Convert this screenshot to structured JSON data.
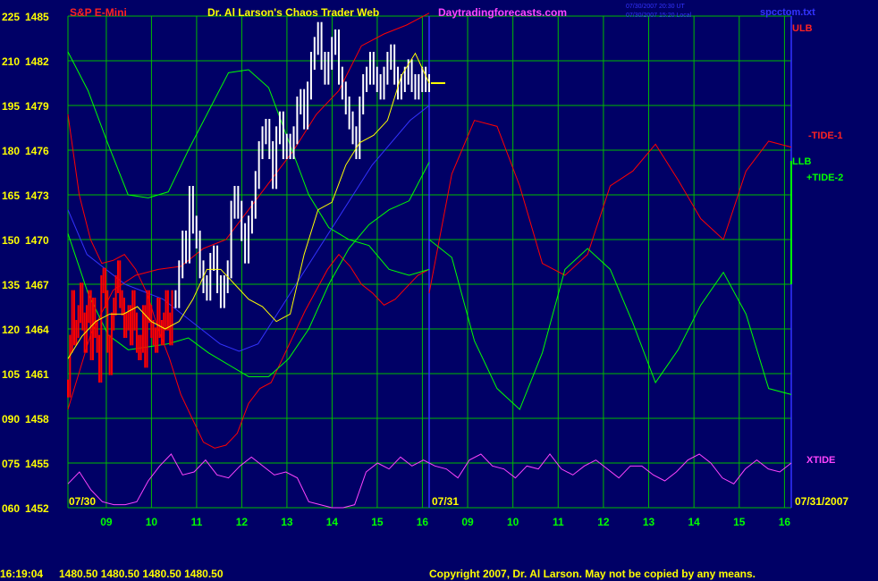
{
  "header": {
    "instrument": "S&P E-Mini",
    "title": "Dr. Al Larson's Chaos Trader Web",
    "site": "Daytradingforecasts.com",
    "stamp_line1": "07/30/2007 20:30 UT",
    "stamp_line2": "07/30/2007 15:20 Local",
    "file": "spcctom.txt"
  },
  "footer": {
    "time": "16:19:04",
    "quotes": "1480.50 1480.50 1480.50 1480.50",
    "copyright": "Copyright 2007, Dr. Al Larson. May not be copied by any means."
  },
  "colors": {
    "background": "#000066",
    "grid": "#00bb00",
    "red": "#ff0000",
    "green": "#00ff00",
    "magenta": "#ff44ff",
    "yellow": "#ffff00",
    "white": "#ffffff",
    "blue": "#3333ff"
  },
  "chart_data": {
    "type": "line",
    "ylim_left": [
      60,
      225
    ],
    "ylim_right": [
      1452,
      1485
    ],
    "y_ticks": [
      {
        "left": "225",
        "right": "1485"
      },
      {
        "left": "210",
        "right": "1482"
      },
      {
        "left": "195",
        "right": "1479"
      },
      {
        "left": "180",
        "right": "1476"
      },
      {
        "left": "165",
        "right": "1473"
      },
      {
        "left": "150",
        "right": "1470"
      },
      {
        "left": "135",
        "right": "1467"
      },
      {
        "left": "120",
        "right": "1464"
      },
      {
        "left": "105",
        "right": "1461"
      },
      {
        "left": "090",
        "right": "1458"
      },
      {
        "left": "075",
        "right": "1455"
      },
      {
        "left": "060",
        "right": "1452"
      }
    ],
    "x_hours": [
      "09",
      "10",
      "11",
      "12",
      "13",
      "14",
      "15",
      "16",
      "09",
      "10",
      "11",
      "12",
      "13",
      "14",
      "15",
      "16"
    ],
    "date_start": "07/30",
    "date_mid": "07/31",
    "date_end": "07/31/2007",
    "series_labels": {
      "ulb": "ULB",
      "tide1": "-TIDE-1",
      "llb": "LLB",
      "tide2": "+TIDE-2",
      "xtide": "XTIDE"
    },
    "t_axis": [
      0,
      0.5,
      1,
      1.5,
      2,
      2.5,
      3,
      3.5,
      4,
      4.5,
      5,
      5.5,
      6,
      6.5,
      7,
      7.5,
      8,
      8.5,
      9,
      9.5,
      10,
      10.5,
      11,
      11.5,
      12,
      12.5,
      13,
      13.5,
      14,
      14.5,
      15,
      15.5,
      16
    ],
    "ulb_red": [
      192,
      165,
      150,
      142,
      143,
      145,
      140,
      132,
      120,
      110,
      98,
      90,
      82,
      80,
      81,
      85,
      95,
      100,
      102,
      110,
      118,
      126,
      133,
      140,
      145,
      141,
      135,
      132,
      128,
      130,
      134,
      138,
      140
    ],
    "lower_red": [
      93,
      118,
      133,
      138,
      140,
      141,
      147,
      150,
      160,
      170,
      180,
      192,
      200,
      215,
      219,
      222,
      226
    ],
    "tide1_red": [
      132,
      172,
      190,
      188,
      168,
      142,
      138,
      145,
      168,
      173,
      182,
      170,
      157,
      150,
      173,
      183,
      181
    ],
    "llb_green": [
      213,
      200,
      182,
      165,
      164,
      166,
      180,
      193,
      206,
      207,
      201,
      183,
      165,
      154,
      150,
      148,
      140,
      138,
      140
    ],
    "upper_green": [
      152,
      132,
      118,
      113,
      114,
      115,
      117,
      112,
      108,
      104,
      104,
      110,
      120,
      135,
      147,
      155,
      160,
      163,
      176
    ],
    "tide2_green": [
      150,
      144,
      116,
      100,
      93,
      112,
      140,
      147,
      140,
      122,
      102,
      113,
      128,
      139,
      125,
      100,
      98
    ],
    "xtide_mag": [
      68,
      72,
      66,
      62,
      61,
      61,
      62,
      69,
      74,
      78,
      71,
      72,
      76,
      71,
      70,
      74,
      77,
      74,
      71,
      72,
      70,
      62,
      61,
      60,
      60,
      61,
      72,
      75,
      73,
      77,
      74,
      76,
      74,
      73,
      70,
      76,
      78,
      74,
      73,
      70,
      74,
      73,
      78,
      73,
      71,
      74,
      76,
      73,
      70,
      74,
      74,
      71,
      69,
      72,
      76,
      78,
      75,
      70,
      68,
      73,
      76,
      73,
      72,
      75
    ],
    "price_red_t": [
      0,
      0.3,
      0.6,
      0.9,
      1.2,
      1.5,
      1.8,
      2.1,
      2.4,
      2.7,
      3.0,
      3.3,
      3.6,
      3.9,
      4.2,
      4.5,
      4.8,
      5.1,
      5.4,
      5.7,
      6.0,
      6.3,
      6.6,
      6.9,
      7.2,
      7.5,
      7.8,
      8.1,
      8.4,
      8.7,
      9.0,
      9.3,
      9.6,
      9.9,
      10.2,
      10.5,
      10.8,
      11.1,
      11.4,
      11.7,
      12.0,
      12.3,
      12.6,
      12.9,
      13.2,
      13.5,
      13.8,
      14.1,
      14.4,
      14.7,
      15.0
    ],
    "price_red": [
      1460,
      1463,
      1466,
      1463.5,
      1464,
      1465,
      1466.5,
      1464.5,
      1463,
      1465,
      1466,
      1462.5,
      1465.5,
      1464,
      1463,
      1461,
      1467,
      1467.5,
      1466,
      1463,
      1461.5,
      1464.5,
      1465.5,
      1467,
      1468,
      1466,
      1465.5,
      1464,
      1464.5,
      1465,
      1463.5,
      1466,
      1464.5,
      1463,
      1462.5,
      1463,
      1465,
      1462,
      1466,
      1465,
      1464,
      1463.5,
      1463,
      1465.5,
      1464,
      1463.5,
      1464.5,
      1466,
      1464.5,
      1463.5,
      1466
    ],
    "price_white_t": [
      15.5,
      16,
      16.5,
      17,
      17.5,
      18,
      18.5,
      19,
      19.5,
      20,
      20.5,
      21,
      21.5,
      22,
      22.5,
      23,
      23.5,
      24,
      24.5,
      25,
      25.5,
      26,
      26.5,
      27,
      27.5,
      28,
      28.5,
      29,
      29.5,
      30,
      30.5,
      31,
      31.5,
      32,
      32.5,
      33,
      33.5,
      34,
      34.5,
      35,
      35.5,
      36,
      36.5,
      37,
      37.5,
      38,
      38.5,
      39,
      39.5,
      40,
      40.5,
      41,
      41.5,
      42,
      42.5,
      43,
      43.5,
      44,
      44.5,
      45,
      45.5,
      46,
      46.5,
      47,
      47.5,
      48,
      48.5,
      49,
      49.5,
      50,
      50.5,
      51,
      51.5,
      52
    ],
    "price_white": [
      1466,
      1468,
      1470,
      1469,
      1473,
      1471,
      1470,
      1468,
      1467,
      1466.5,
      1468.5,
      1469,
      1467,
      1466,
      1467,
      1468,
      1472,
      1473,
      1472,
      1470.5,
      1469,
      1471,
      1472,
      1474,
      1476,
      1477,
      1477.5,
      1476,
      1474,
      1477,
      1478,
      1476,
      1476.5,
      1476,
      1477,
      1479,
      1479.5,
      1478,
      1480,
      1482,
      1483,
      1484,
      1482,
      1481,
      1482,
      1483,
      1483.5,
      1481,
      1480,
      1479,
      1478,
      1477,
      1476,
      1479,
      1480.5,
      1481,
      1482,
      1481,
      1480.5,
      1480,
      1481,
      1482,
      1482.5,
      1481,
      1480,
      1480.5,
      1481,
      1481.5,
      1480.5,
      1480,
      1480.5,
      1481,
      1480.5,
      1480.5
    ],
    "avg_yellow_t": [
      0,
      2,
      4,
      6,
      8,
      10,
      12,
      14,
      16,
      18,
      20,
      22,
      24,
      26,
      28,
      30,
      32,
      34,
      36,
      38,
      40,
      42,
      44,
      46,
      48,
      50,
      52
    ],
    "avg_yellow": [
      1462,
      1463.5,
      1464.5,
      1465,
      1465,
      1465.5,
      1464.5,
      1464,
      1464.5,
      1466,
      1468,
      1468,
      1467,
      1466,
      1465.5,
      1464.5,
      1465,
      1469,
      1472,
      1472.5,
      1475,
      1476.5,
      1477,
      1478,
      1481,
      1482.5,
      1480.5
    ],
    "forecast_level": 1480.5
  }
}
